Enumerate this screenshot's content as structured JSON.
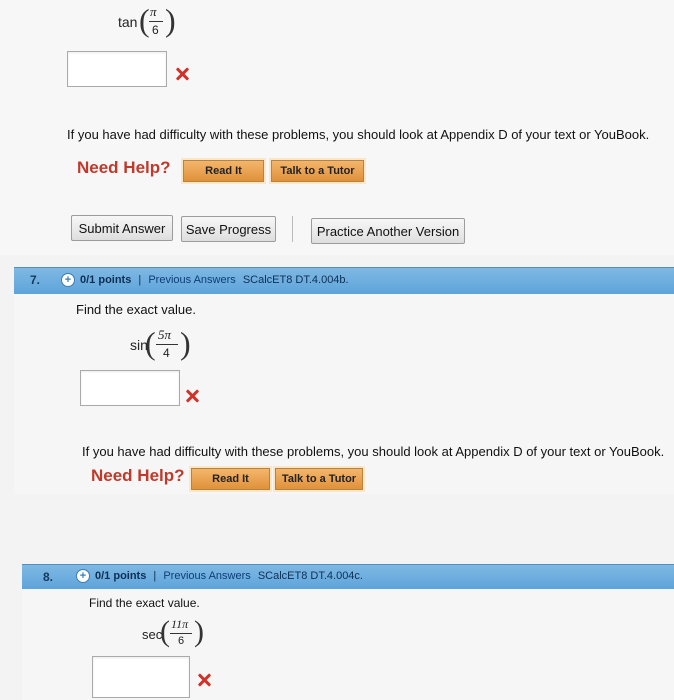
{
  "problem6": {
    "func": "tan",
    "numerator": "π",
    "denominator": "6",
    "help_text": "If you have had difficulty with these problems, you should look at Appendix D of your text or YouBook.",
    "need_help": "Need Help?",
    "read_it": "Read It",
    "talk_tutor": "Talk to a Tutor",
    "submit": "Submit Answer",
    "save": "Save Progress",
    "practice": "Practice Another Version"
  },
  "problem7": {
    "number": "7.",
    "points": "0/1 points",
    "separator": "|",
    "previous": "Previous Answers",
    "code": "SCalcET8 DT.4.004b.",
    "prompt": "Find the exact value.",
    "func": "sin",
    "numerator": "5π",
    "denominator": "4",
    "help_text": "If you have had difficulty with these problems, you should look at Appendix D of your text or YouBook.",
    "need_help": "Need Help?",
    "read_it": "Read It",
    "talk_tutor": "Talk to a Tutor"
  },
  "problem8": {
    "number": "8.",
    "points": "0/1 points",
    "separator": "|",
    "previous": "Previous Answers",
    "code": "SCalcET8 DT.4.004c.",
    "prompt": "Find the exact value.",
    "func": "sec",
    "numerator": "11π",
    "denominator": "6"
  },
  "colors": {
    "bar": "#6aaade",
    "error": "#d0322a",
    "need_help": "#c0392b",
    "read_button": "#e9a152"
  }
}
